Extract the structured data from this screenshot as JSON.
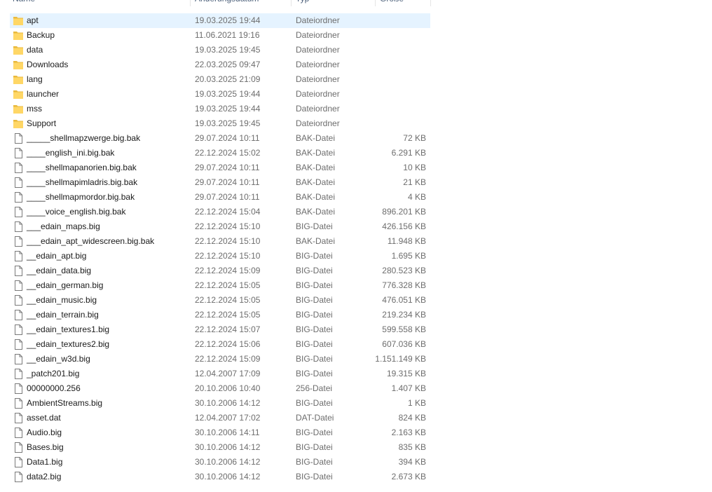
{
  "columns": {
    "name": "Name",
    "date": "Änderungsdatum",
    "type": "Typ",
    "size": "Größe"
  },
  "colors": {
    "folder": "#ffd766",
    "folder_dark": "#e9b93d",
    "selection": "#e5f3ff"
  },
  "files": [
    {
      "name": "apt",
      "date": "19.03.2025 19:44",
      "type": "Dateiordner",
      "size": "",
      "icon": "folder-icon",
      "selected": true
    },
    {
      "name": "Backup",
      "date": "11.06.2021 19:16",
      "type": "Dateiordner",
      "size": "",
      "icon": "folder-icon"
    },
    {
      "name": "data",
      "date": "19.03.2025 19:45",
      "type": "Dateiordner",
      "size": "",
      "icon": "folder-icon"
    },
    {
      "name": "Downloads",
      "date": "22.03.2025 09:47",
      "type": "Dateiordner",
      "size": "",
      "icon": "folder-icon"
    },
    {
      "name": "lang",
      "date": "20.03.2025 21:09",
      "type": "Dateiordner",
      "size": "",
      "icon": "folder-icon"
    },
    {
      "name": "launcher",
      "date": "19.03.2025 19:44",
      "type": "Dateiordner",
      "size": "",
      "icon": "folder-icon"
    },
    {
      "name": "mss",
      "date": "19.03.2025 19:44",
      "type": "Dateiordner",
      "size": "",
      "icon": "folder-icon"
    },
    {
      "name": "Support",
      "date": "19.03.2025 19:45",
      "type": "Dateiordner",
      "size": "",
      "icon": "folder-icon"
    },
    {
      "name": "_____shellmapzwerge.big.bak",
      "date": "29.07.2024 10:11",
      "type": "BAK-Datei",
      "size": "72 KB",
      "icon": "file-icon"
    },
    {
      "name": "____english_ini.big.bak",
      "date": "22.12.2024 15:02",
      "type": "BAK-Datei",
      "size": "6.291 KB",
      "icon": "file-icon"
    },
    {
      "name": "____shellmapanorien.big.bak",
      "date": "29.07.2024 10:11",
      "type": "BAK-Datei",
      "size": "10 KB",
      "icon": "file-icon"
    },
    {
      "name": "____shellmapimladris.big.bak",
      "date": "29.07.2024 10:11",
      "type": "BAK-Datei",
      "size": "21 KB",
      "icon": "file-icon"
    },
    {
      "name": "____shellmapmordor.big.bak",
      "date": "29.07.2024 10:11",
      "type": "BAK-Datei",
      "size": "4 KB",
      "icon": "file-icon"
    },
    {
      "name": "____voice_english.big.bak",
      "date": "22.12.2024 15:04",
      "type": "BAK-Datei",
      "size": "896.201 KB",
      "icon": "file-icon"
    },
    {
      "name": "___edain_maps.big",
      "date": "22.12.2024 15:10",
      "type": "BIG-Datei",
      "size": "426.156 KB",
      "icon": "file-icon"
    },
    {
      "name": "___edain_apt_widescreen.big.bak",
      "date": "22.12.2024 15:10",
      "type": "BAK-Datei",
      "size": "11.948 KB",
      "icon": "file-icon"
    },
    {
      "name": "__edain_apt.big",
      "date": "22.12.2024 15:10",
      "type": "BIG-Datei",
      "size": "1.695 KB",
      "icon": "file-icon"
    },
    {
      "name": "__edain_data.big",
      "date": "22.12.2024 15:09",
      "type": "BIG-Datei",
      "size": "280.523 KB",
      "icon": "file-icon"
    },
    {
      "name": "__edain_german.big",
      "date": "22.12.2024 15:05",
      "type": "BIG-Datei",
      "size": "776.328 KB",
      "icon": "file-icon"
    },
    {
      "name": "__edain_music.big",
      "date": "22.12.2024 15:05",
      "type": "BIG-Datei",
      "size": "476.051 KB",
      "icon": "file-icon"
    },
    {
      "name": "__edain_terrain.big",
      "date": "22.12.2024 15:05",
      "type": "BIG-Datei",
      "size": "219.234 KB",
      "icon": "file-icon"
    },
    {
      "name": "__edain_textures1.big",
      "date": "22.12.2024 15:07",
      "type": "BIG-Datei",
      "size": "599.558 KB",
      "icon": "file-icon"
    },
    {
      "name": "__edain_textures2.big",
      "date": "22.12.2024 15:06",
      "type": "BIG-Datei",
      "size": "607.036 KB",
      "icon": "file-icon"
    },
    {
      "name": "__edain_w3d.big",
      "date": "22.12.2024 15:09",
      "type": "BIG-Datei",
      "size": "1.151.149 KB",
      "icon": "file-icon"
    },
    {
      "name": "_patch201.big",
      "date": "12.04.2007 17:09",
      "type": "BIG-Datei",
      "size": "19.315 KB",
      "icon": "file-icon"
    },
    {
      "name": "00000000.256",
      "date": "20.10.2006 10:40",
      "type": "256-Datei",
      "size": "1.407 KB",
      "icon": "file-icon"
    },
    {
      "name": "AmbientStreams.big",
      "date": "30.10.2006 14:12",
      "type": "BIG-Datei",
      "size": "1 KB",
      "icon": "file-icon"
    },
    {
      "name": "asset.dat",
      "date": "12.04.2007 17:02",
      "type": "DAT-Datei",
      "size": "824 KB",
      "icon": "file-icon"
    },
    {
      "name": "Audio.big",
      "date": "30.10.2006 14:11",
      "type": "BIG-Datei",
      "size": "2.163 KB",
      "icon": "file-icon"
    },
    {
      "name": "Bases.big",
      "date": "30.10.2006 14:12",
      "type": "BIG-Datei",
      "size": "835 KB",
      "icon": "file-icon"
    },
    {
      "name": "Data1.big",
      "date": "30.10.2006 14:12",
      "type": "BIG-Datei",
      "size": "394 KB",
      "icon": "file-icon"
    },
    {
      "name": "data2.big",
      "date": "30.10.2006 14:12",
      "type": "BIG-Datei",
      "size": "2.673 KB",
      "icon": "file-icon"
    }
  ]
}
